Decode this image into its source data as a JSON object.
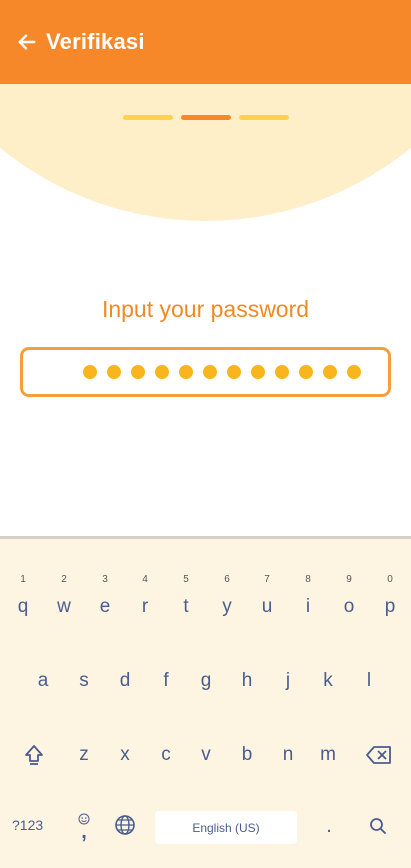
{
  "header": {
    "title": "Verifikasi",
    "back_icon": "arrow-left-icon",
    "background": "#F7882A"
  },
  "progress": {
    "steps": 3,
    "active_step": 2,
    "active_color": "#F7882A",
    "inactive_color": "#FFD24C"
  },
  "form": {
    "prompt": "Input your password",
    "password_length": 12,
    "accent_color": "#F3A03A"
  },
  "keyboard": {
    "row1": [
      {
        "key": "q",
        "hint": "1"
      },
      {
        "key": "w",
        "hint": "2"
      },
      {
        "key": "e",
        "hint": "3"
      },
      {
        "key": "r",
        "hint": "4"
      },
      {
        "key": "t",
        "hint": "5"
      },
      {
        "key": "y",
        "hint": "6"
      },
      {
        "key": "u",
        "hint": "7"
      },
      {
        "key": "i",
        "hint": "8"
      },
      {
        "key": "o",
        "hint": "9"
      },
      {
        "key": "p",
        "hint": "0"
      }
    ],
    "row2": [
      "a",
      "s",
      "d",
      "f",
      "g",
      "h",
      "j",
      "k",
      "l"
    ],
    "row3": [
      "z",
      "x",
      "c",
      "v",
      "b",
      "n",
      "m"
    ],
    "symbols_label": "?123",
    "comma_label": ",",
    "space_label": "English (US)",
    "period_label": ".",
    "shift_icon": "shift-icon",
    "backspace_icon": "backspace-icon",
    "emoji_icon": "emoji-icon",
    "globe_icon": "globe-icon",
    "search_icon": "search-icon"
  }
}
